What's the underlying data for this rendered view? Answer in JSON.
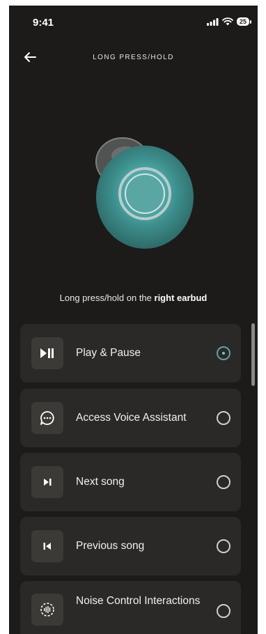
{
  "status": {
    "time": "9:41",
    "battery": "25"
  },
  "header": {
    "title": "LONG PRESS/HOLD"
  },
  "instruction": {
    "prefix": "Long press/hold on the ",
    "bold": "right earbud"
  },
  "options": [
    {
      "label": "Play & Pause",
      "icon": "play-pause-icon",
      "selected": true
    },
    {
      "label": "Access Voice Assistant",
      "icon": "voice-assistant-icon",
      "selected": false
    },
    {
      "label": "Next song",
      "icon": "next-track-icon",
      "selected": false
    },
    {
      "label": "Previous song",
      "icon": "previous-track-icon",
      "selected": false
    },
    {
      "label": "Noise Control Interactions",
      "icon": "noise-control-icon",
      "selected": false
    }
  ],
  "colors": {
    "background": "#1c1b19",
    "card": "#2a2927",
    "accent": "#5fa3a4"
  }
}
